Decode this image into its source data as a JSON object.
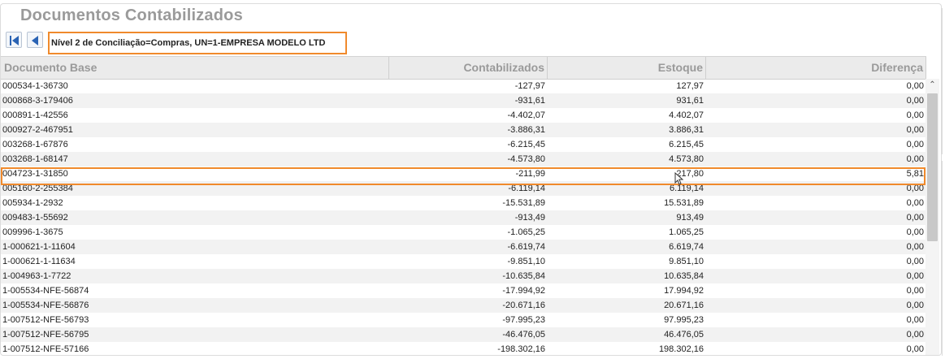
{
  "window": {
    "title": "Documentos Contabilizados"
  },
  "toolbar": {
    "first_icon": "first-page-icon",
    "prev_icon": "previous-page-icon",
    "level_text": "Nível 2 de  Conciliação=Compras, UN=1-EMPRESA MODELO LTD"
  },
  "table": {
    "columns": [
      "Documento  Base",
      "Contabilizados",
      "Estoque",
      "Diferença"
    ],
    "rows": [
      [
        "000534-1-36730",
        "-127,97",
        "127,97",
        "0,00"
      ],
      [
        "000868-3-179406",
        "-931,61",
        "931,61",
        "0,00"
      ],
      [
        "000891-1-42556",
        "-4.402,07",
        "4.402,07",
        "0,00"
      ],
      [
        "000927-2-467951",
        "-3.886,31",
        "3.886,31",
        "0,00"
      ],
      [
        "003268-1-67876",
        "-6.215,45",
        "6.215,45",
        "0,00"
      ],
      [
        "003268-1-68147",
        "-4.573,80",
        "4.573,80",
        "0,00"
      ],
      [
        "004723-1-31850",
        "-211,99",
        "217,80",
        "5,81"
      ],
      [
        "005160-2-255384",
        "-6.119,14",
        "6.119,14",
        "0,00"
      ],
      [
        "005934-1-2932",
        "-15.531,89",
        "15.531,89",
        "0,00"
      ],
      [
        "009483-1-55692",
        "-913,49",
        "913,49",
        "0,00"
      ],
      [
        "009996-1-3675",
        "-1.065,25",
        "1.065,25",
        "0,00"
      ],
      [
        "1-000621-1-11604",
        "-6.619,74",
        "6.619,74",
        "0,00"
      ],
      [
        "1-000621-1-11634",
        "-9.851,10",
        "9.851,10",
        "0,00"
      ],
      [
        "1-004963-1-7722",
        "-10.635,84",
        "10.635,84",
        "0,00"
      ],
      [
        "1-005534-NFE-56874",
        "-17.994,92",
        "17.994,92",
        "0,00"
      ],
      [
        "1-005534-NFE-56876",
        "-20.671,16",
        "20.671,16",
        "0,00"
      ],
      [
        "1-007512-NFE-56793",
        "-97.995,23",
        "97.995,23",
        "0,00"
      ],
      [
        "1-007512-NFE-56795",
        "-46.476,05",
        "46.476,05",
        "0,00"
      ],
      [
        "1-007512-NFE-57166",
        "-198.302,16",
        "198.302,16",
        "0,00"
      ]
    ],
    "selected_row_index": 6
  },
  "scrollbar": {
    "up_icon": "scroll-up-arrow-icon"
  },
  "colors": {
    "highlight_border": "#f08a2c",
    "nav_icon": "#2a63b4",
    "title_text": "#9a9a9a"
  }
}
